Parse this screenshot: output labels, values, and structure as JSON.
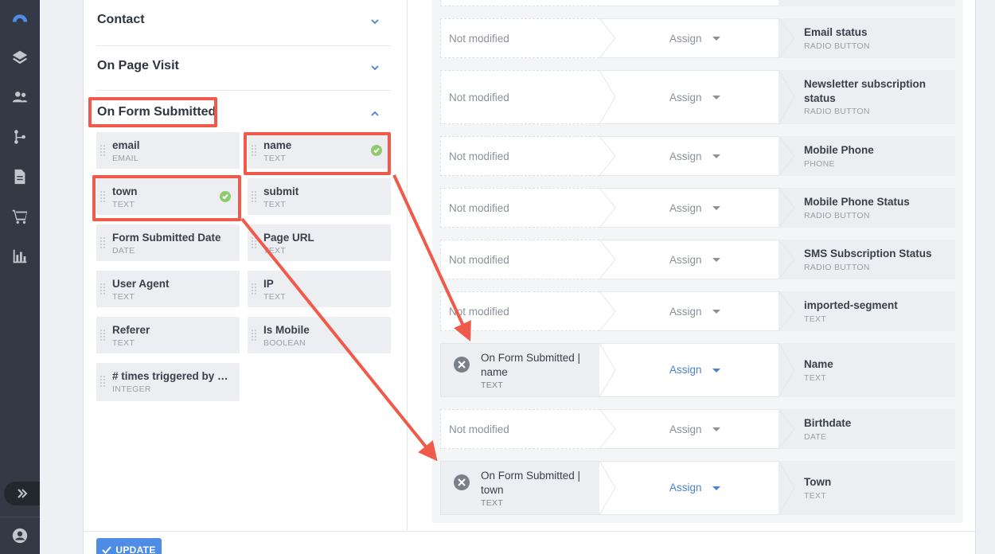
{
  "nav": {
    "icons": [
      "logo-icon",
      "layers-icon",
      "users-icon",
      "workflow-icon",
      "document-icon",
      "cart-icon",
      "chart-icon",
      "expand-icon",
      "account-icon"
    ]
  },
  "sections": [
    {
      "title": "Contact",
      "state": "collapsed"
    },
    {
      "title": "On Page Visit",
      "state": "collapsed"
    },
    {
      "title": "On Form Submitted",
      "state": "expanded"
    }
  ],
  "fields": [
    {
      "name": "email",
      "type": "EMAIL",
      "checked": false
    },
    {
      "name": "name",
      "type": "TEXT",
      "checked": true
    },
    {
      "name": "town",
      "type": "TEXT",
      "checked": true
    },
    {
      "name": "submit",
      "type": "TEXT",
      "checked": false
    },
    {
      "name": "Form Submitted Date",
      "type": "DATE",
      "checked": false
    },
    {
      "name": "Page URL",
      "type": "TEXT",
      "checked": false
    },
    {
      "name": "User Agent",
      "type": "TEXT",
      "checked": false
    },
    {
      "name": "IP",
      "type": "TEXT",
      "checked": false
    },
    {
      "name": "Referer",
      "type": "TEXT",
      "checked": false
    },
    {
      "name": "Is Mobile",
      "type": "BOOLEAN",
      "checked": false
    },
    {
      "name": "# times triggered by th…",
      "type": "INTEGER",
      "checked": false
    }
  ],
  "mappings": [
    {
      "source": "Not modified",
      "action": "Assign",
      "target": "Email status",
      "target_type": "RADIO BUTTON"
    },
    {
      "source": "Not modified",
      "action": "Assign",
      "target": "Newsletter subscription status",
      "target_type": "RADIO BUTTON"
    },
    {
      "source": "Not modified",
      "action": "Assign",
      "target": "Mobile Phone",
      "target_type": "PHONE"
    },
    {
      "source": "Not modified",
      "action": "Assign",
      "target": "Mobile Phone Status",
      "target_type": "RADIO BUTTON"
    },
    {
      "source": "Not modified",
      "action": "Assign",
      "target": "SMS Subscription Status",
      "target_type": "RADIO BUTTON"
    },
    {
      "source": "Not modified",
      "action": "Assign",
      "target": "imported-segment",
      "target_type": "TEXT"
    },
    {
      "source": "On Form Submitted | name",
      "source_type": "TEXT",
      "mapped": true,
      "action": "Assign",
      "target": "Name",
      "target_type": "TEXT"
    },
    {
      "source": "Not modified",
      "action": "Assign",
      "target": "Birthdate",
      "target_type": "DATE"
    },
    {
      "source": "On Form Submitted | town",
      "source_type": "TEXT",
      "mapped": true,
      "action": "Assign",
      "target": "Town",
      "target_type": "TEXT"
    }
  ],
  "update_label": "UPDATE",
  "colors": {
    "highlight": "#ef5a4a",
    "accent": "#4a7fd6",
    "check": "#8fcb6e",
    "nav_bg": "#333a46"
  }
}
